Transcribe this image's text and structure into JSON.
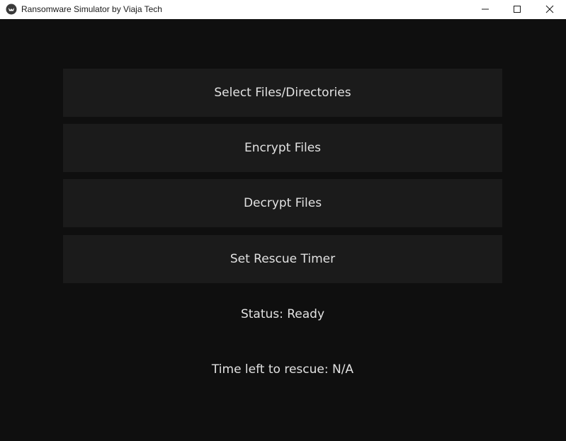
{
  "window": {
    "title": "Ransomware Simulator by Viaja Tech",
    "app_icon": "kivy-logo-icon",
    "controls": {
      "minimize": "minimize-icon",
      "maximize": "maximize-icon",
      "close": "close-icon"
    }
  },
  "buttons": {
    "select": "Select Files/Directories",
    "encrypt": "Encrypt Files",
    "decrypt": "Decrypt Files",
    "timer": "Set Rescue Timer"
  },
  "status_text": "Status: Ready",
  "rescue_time_text": "Time left to rescue: N/A",
  "colors": {
    "background": "#0f0f0f",
    "button_bg": "#1b1b1b",
    "text": "#e2e2e2",
    "titlebar": "#ffffff"
  }
}
